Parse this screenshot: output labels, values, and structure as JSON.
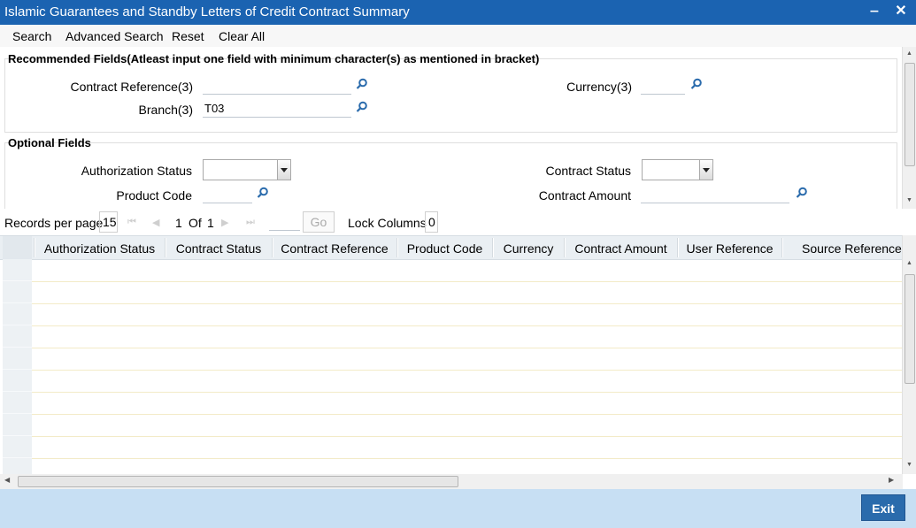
{
  "window": {
    "title": "Islamic Guarantees and Standby Letters of Credit Contract Summary",
    "minimize": "‒",
    "close": "✕"
  },
  "toolbar": {
    "search": "Search",
    "advanced_search": "Advanced Search",
    "reset": "Reset",
    "clear_all": "Clear All"
  },
  "recommended": {
    "title": "Recommended Fields(Atleast input one field with minimum character(s) as mentioned in bracket)",
    "contract_reference_label": "Contract Reference(3)",
    "contract_reference_value": "",
    "currency_label": "Currency(3)",
    "currency_value": "",
    "branch_label": "Branch(3)",
    "branch_value": "T03"
  },
  "optional": {
    "title": "Optional Fields",
    "authorization_status_label": "Authorization Status",
    "authorization_status_value": "",
    "contract_status_label": "Contract Status",
    "contract_status_value": "",
    "product_code_label": "Product Code",
    "product_code_value": "",
    "contract_amount_label": "Contract Amount",
    "contract_amount_value": ""
  },
  "pager": {
    "records_per_page_label": "Records per page",
    "records_per_page": "15",
    "current_page": "1",
    "of_label": "Of",
    "total_pages": "1",
    "goto_value": "",
    "go_label": "Go",
    "lock_columns_label": "Lock Columns",
    "lock_columns": "0"
  },
  "grid": {
    "columns": [
      "Authorization Status",
      "Contract Status",
      "Contract Reference",
      "Product Code",
      "Currency",
      "Contract Amount",
      "User Reference",
      "Source Reference"
    ],
    "rows": 10
  },
  "footer": {
    "exit_label": "Exit"
  },
  "colors": {
    "titlebar": "#1b63b1",
    "footer": "#c7dff3",
    "exit_button": "#2a6bac",
    "grid_header": "#eaeff3"
  },
  "icons": [
    "search-icon",
    "dropdown-arrow-icon",
    "first-page-icon",
    "prev-page-icon",
    "next-page-icon",
    "last-page-icon"
  ]
}
